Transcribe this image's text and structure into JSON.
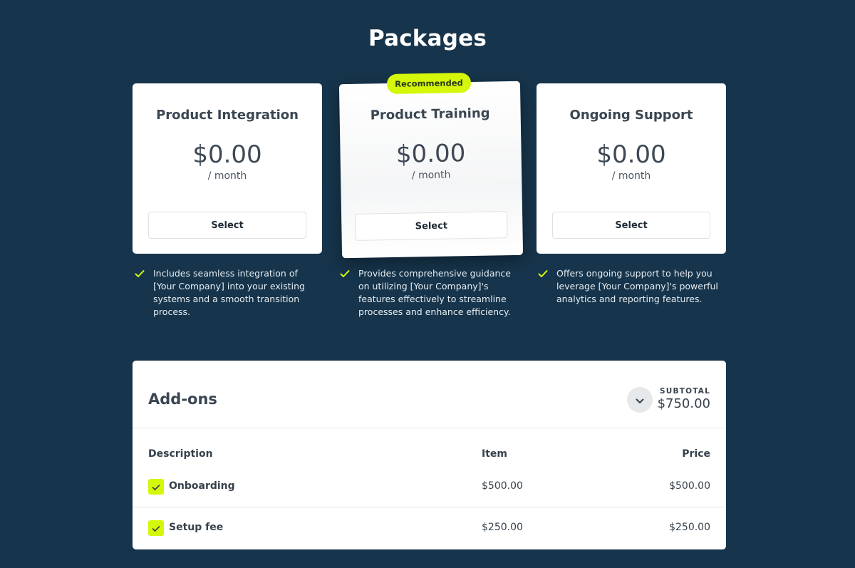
{
  "header": {
    "title": "Packages"
  },
  "packages": [
    {
      "name": "Product Integration",
      "price": "$0.00",
      "period": "/ month",
      "select_label": "Select",
      "feature": "Includes seamless integration of [Your Company] into your existing systems and a smooth transition process."
    },
    {
      "name": "Product Training",
      "price": "$0.00",
      "period": "/ month",
      "select_label": "Select",
      "badge": "Recommended",
      "feature": "Provides comprehensive guidance on utilizing [Your Company]'s features effectively to streamline processes and enhance efficiency."
    },
    {
      "name": "Ongoing Support",
      "price": "$0.00",
      "period": "/ month",
      "select_label": "Select",
      "feature": "Offers ongoing support to help you leverage [Your Company]'s powerful analytics and reporting features."
    }
  ],
  "addons": {
    "title": "Add-ons",
    "subtotal_label": "SUBTOTAL",
    "subtotal_value": "$750.00",
    "columns": {
      "description": "Description",
      "item": "Item",
      "price": "Price"
    },
    "rows": [
      {
        "description": "Onboarding",
        "item": "$500.00",
        "price": "$500.00",
        "checked": true
      },
      {
        "description": "Setup fee",
        "item": "$250.00",
        "price": "$250.00",
        "checked": true
      }
    ]
  },
  "colors": {
    "background": "#16344b",
    "accent": "#d4f70a",
    "text_dark": "#36414c",
    "card": "#ffffff"
  },
  "icons": {
    "feature_check": "check-icon",
    "toggle": "chevron-down-icon",
    "row_checkbox": "checkbox-checked-icon"
  }
}
